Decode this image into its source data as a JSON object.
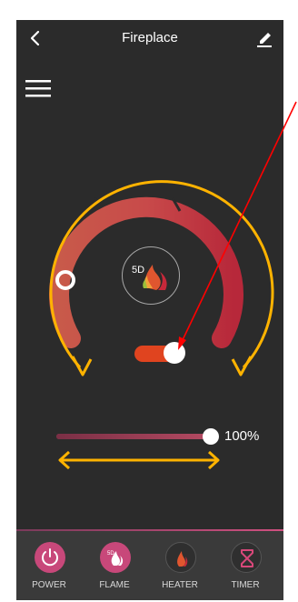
{
  "header": {
    "title": "Fireplace",
    "back_icon": "chevron-left-icon",
    "edit_icon": "edit-pencil-icon"
  },
  "menu": {
    "icon": "hamburger-menu-icon"
  },
  "dial": {
    "center_logo_text": "5D",
    "center_icon": "flame-logo-icon",
    "toggle_on": true
  },
  "slider": {
    "value": 100,
    "label": "100%"
  },
  "footer": {
    "buttons": [
      {
        "label": "POWER",
        "icon": "power-icon"
      },
      {
        "label": "FLAME",
        "icon": "5d-flame-icon"
      },
      {
        "label": "HEATER",
        "icon": "heater-flame-icon"
      },
      {
        "label": "TIMER",
        "icon": "hourglass-icon"
      }
    ]
  },
  "colors": {
    "background": "#2b2b2b",
    "arc_start": "#c85a4a",
    "arc_end": "#b7283a",
    "toggle": "#e0441f",
    "annotation_arrow": "#ffb300",
    "pointer_arrow": "#ff0000",
    "footer_bg": "#3a3a3a"
  }
}
